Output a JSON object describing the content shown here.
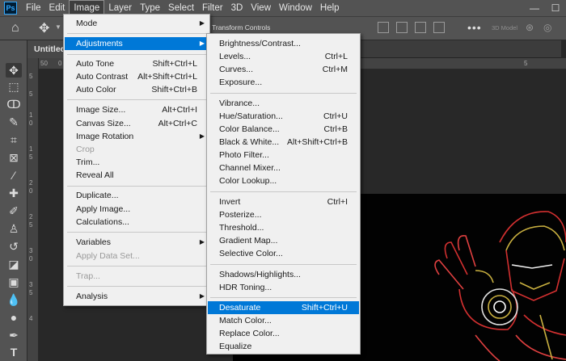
{
  "menubar": {
    "logo": "Ps",
    "items": [
      "File",
      "Edit",
      "Image",
      "Layer",
      "Type",
      "Select",
      "Filter",
      "3D",
      "View",
      "Window",
      "Help"
    ],
    "active_index": 2
  },
  "window_controls": {
    "minimize": "—",
    "maximize": "☐",
    "close": "✕"
  },
  "options_bar": {
    "transform_controls": "Transform Controls",
    "more": "•••",
    "mode_3d": "3D Model"
  },
  "document": {
    "tab_name": "Untitled",
    "ruler_top": [
      "50",
      "0",
      "5"
    ],
    "ruler_left": [
      "5",
      "5",
      "1",
      "0",
      "1",
      "5",
      "2",
      "0",
      "2",
      "5",
      "3",
      "0",
      "3",
      "5",
      "4"
    ]
  },
  "image_menu": {
    "items": [
      {
        "label": "Mode",
        "arrow": true
      },
      {
        "label": "Adjustments",
        "arrow": true,
        "highlighted": true
      },
      {
        "label": "Auto Tone",
        "shortcut": "Shift+Ctrl+L"
      },
      {
        "label": "Auto Contrast",
        "shortcut": "Alt+Shift+Ctrl+L"
      },
      {
        "label": "Auto Color",
        "shortcut": "Shift+Ctrl+B"
      },
      {
        "label": "Image Size...",
        "shortcut": "Alt+Ctrl+I"
      },
      {
        "label": "Canvas Size...",
        "shortcut": "Alt+Ctrl+C"
      },
      {
        "label": "Image Rotation",
        "arrow": true
      },
      {
        "label": "Crop",
        "disabled": true
      },
      {
        "label": "Trim..."
      },
      {
        "label": "Reveal All"
      },
      {
        "label": "Duplicate..."
      },
      {
        "label": "Apply Image..."
      },
      {
        "label": "Calculations..."
      },
      {
        "label": "Variables",
        "arrow": true
      },
      {
        "label": "Apply Data Set...",
        "disabled": true
      },
      {
        "label": "Trap...",
        "disabled": true
      },
      {
        "label": "Analysis",
        "arrow": true
      }
    ]
  },
  "adjustments_menu": {
    "items": [
      {
        "label": "Brightness/Contrast..."
      },
      {
        "label": "Levels...",
        "shortcut": "Ctrl+L"
      },
      {
        "label": "Curves...",
        "shortcut": "Ctrl+M"
      },
      {
        "label": "Exposure..."
      },
      {
        "label": "Vibrance..."
      },
      {
        "label": "Hue/Saturation...",
        "shortcut": "Ctrl+U"
      },
      {
        "label": "Color Balance...",
        "shortcut": "Ctrl+B"
      },
      {
        "label": "Black & White...",
        "shortcut": "Alt+Shift+Ctrl+B"
      },
      {
        "label": "Photo Filter..."
      },
      {
        "label": "Channel Mixer..."
      },
      {
        "label": "Color Lookup..."
      },
      {
        "label": "Invert",
        "shortcut": "Ctrl+I"
      },
      {
        "label": "Posterize..."
      },
      {
        "label": "Threshold..."
      },
      {
        "label": "Gradient Map..."
      },
      {
        "label": "Selective Color..."
      },
      {
        "label": "Shadows/Highlights..."
      },
      {
        "label": "HDR Toning..."
      },
      {
        "label": "Desaturate",
        "shortcut": "Shift+Ctrl+U",
        "highlighted": true
      },
      {
        "label": "Match Color..."
      },
      {
        "label": "Replace Color..."
      },
      {
        "label": "Equalize"
      }
    ]
  },
  "colors": {
    "highlight": "#0078d7",
    "menu_bg": "#f0f0f0",
    "chrome": "#535353",
    "canvas": "#282828"
  }
}
